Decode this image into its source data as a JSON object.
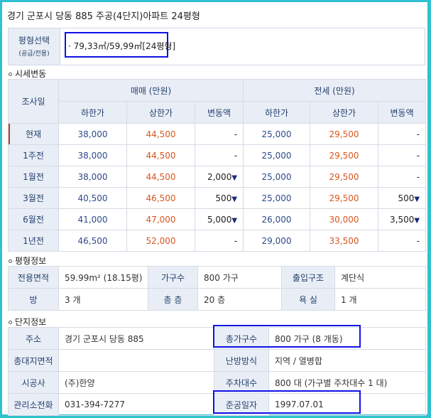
{
  "title": "경기 군포시 당동 885 주공(4단지)아파트 24평형",
  "size_select": {
    "label": "평형선택",
    "sublabel": "(공급/전용)",
    "value": "· 79,33㎡/59,99㎡[24평형]"
  },
  "price_section": {
    "heading": "시세변동",
    "col_date": "조사일",
    "group_sale": "매매 (만원)",
    "group_jeonse": "전세 (만원)",
    "sub_low": "하한가",
    "sub_high": "상한가",
    "sub_change": "변동액",
    "rows": [
      {
        "label": "현재",
        "s_low": "38,000",
        "s_high": "44,500",
        "s_chg": "-",
        "s_arrow": "",
        "j_low": "25,000",
        "j_high": "29,500",
        "j_chg": "-",
        "j_arrow": ""
      },
      {
        "label": "1주전",
        "s_low": "38,000",
        "s_high": "44,500",
        "s_chg": "-",
        "s_arrow": "",
        "j_low": "25,000",
        "j_high": "29,500",
        "j_chg": "-",
        "j_arrow": ""
      },
      {
        "label": "1월전",
        "s_low": "38,000",
        "s_high": "44,500",
        "s_chg": "2,000",
        "s_arrow": "▼",
        "j_low": "25,000",
        "j_high": "29,500",
        "j_chg": "-",
        "j_arrow": ""
      },
      {
        "label": "3월전",
        "s_low": "40,500",
        "s_high": "46,500",
        "s_chg": "500",
        "s_arrow": "▼",
        "j_low": "25,000",
        "j_high": "29,500",
        "j_chg": "500",
        "j_arrow": "▼"
      },
      {
        "label": "6월전",
        "s_low": "41,000",
        "s_high": "47,000",
        "s_chg": "5,000",
        "s_arrow": "▼",
        "j_low": "26,000",
        "j_high": "30,000",
        "j_chg": "3,500",
        "j_arrow": "▼"
      },
      {
        "label": "1년전",
        "s_low": "46,500",
        "s_high": "52,000",
        "s_chg": "-",
        "s_arrow": "",
        "j_low": "29,000",
        "j_high": "33,500",
        "j_chg": "-",
        "j_arrow": ""
      }
    ]
  },
  "area_section": {
    "heading": "평형정보",
    "exclusive_area_label": "전용면적",
    "exclusive_area_value": "59.99m² (18.15평)",
    "households_label": "가구수",
    "households_value": "800 가구",
    "entrance_label": "출입구조",
    "entrance_value": "계단식",
    "rooms_label": "방",
    "rooms_value": "3 개",
    "floors_label": "총 층",
    "floors_value": "20 층",
    "bath_label": "욕 실",
    "bath_value": "1 개"
  },
  "complex_section": {
    "heading": "단지정보",
    "address_label": "주소",
    "address_value": "경기 군포시 당동 885",
    "total_households_label": "총가구수",
    "total_households_value": "800 가구 (8 개동)",
    "land_area_label": "총대지면적",
    "land_area_value": "",
    "heating_label": "난방방식",
    "heating_value": "지역 / 열병합",
    "builder_label": "시공사",
    "builder_value": "(주)한양",
    "parking_label": "주차대수",
    "parking_value": "800 대 (가구별 주차대수 1 대)",
    "office_phone_label": "관리소전화",
    "office_phone_value": "031-394-7277",
    "completion_label": "준공일자",
    "completion_value": "1997.07.01"
  },
  "colors": {
    "frame": "#2fc1cf",
    "header_bg": "#e9eef6",
    "sale_high": "#d9551c",
    "highlight": "#1111e8"
  }
}
